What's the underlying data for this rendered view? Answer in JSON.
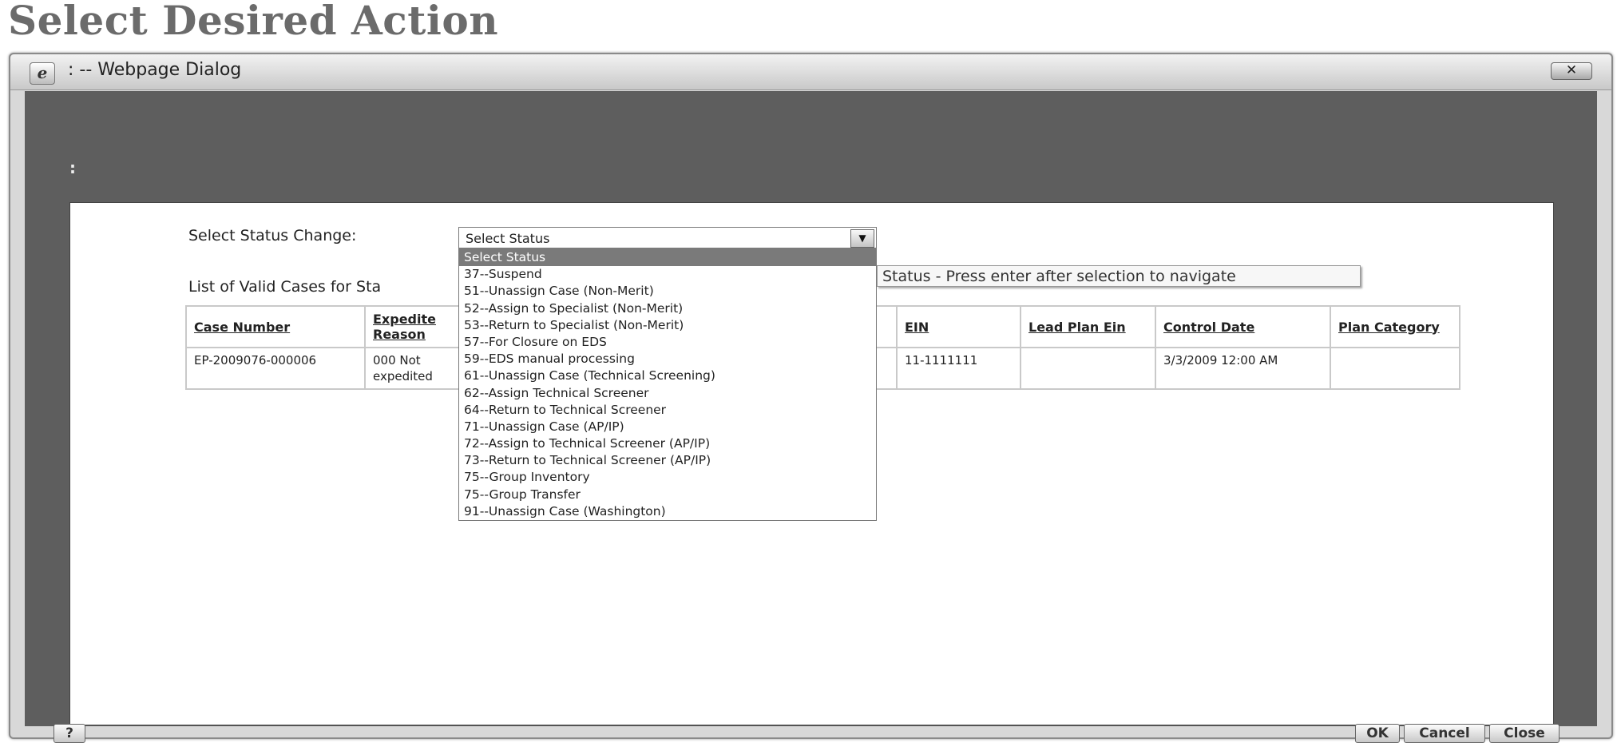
{
  "page": {
    "title": "Select Desired Action"
  },
  "dialog": {
    "title": ": -- Webpage Dialog",
    "close_label": "✕",
    "top_label": ":",
    "help_label": "?",
    "buttons": {
      "ok": "OK",
      "cancel": "Cancel",
      "close": "Close"
    }
  },
  "status_change": {
    "label": "Select Status Change:",
    "selected": "Select Status",
    "tooltip": "Status - Press enter after selection to navigate",
    "options": [
      "Select Status",
      "37--Suspend",
      "51--Unassign Case (Non-Merit)",
      "52--Assign to Specialist (Non-Merit)",
      "53--Return to Specialist (Non-Merit)",
      "57--For Closure on EDS",
      "59--EDS manual processing",
      "61--Unassign Case (Technical Screening)",
      "62--Assign Technical Screener",
      "64--Return to Technical Screener",
      "71--Unassign Case (AP/IP)",
      "72--Assign to Technical Screener (AP/IP)",
      "73--Return to Technical Screener (AP/IP)",
      "75--Group Inventory",
      "75--Group Transfer",
      "91--Unassign Case (Washington)"
    ]
  },
  "cases": {
    "heading": "List of Valid Cases for Sta",
    "columns": [
      "Case Number",
      "Expedite Reason",
      "",
      "EIN",
      "Lead Plan Ein",
      "Control Date",
      "Plan Category"
    ],
    "rows": [
      [
        "EP-2009076-000006",
        "000 Not expedited",
        "",
        "11-1111111",
        "",
        "3/3/2009 12:00 AM",
        ""
      ]
    ]
  },
  "colors": {
    "dialog_bg": "#5e5e5e",
    "selected_option": "#7a7a7a"
  }
}
